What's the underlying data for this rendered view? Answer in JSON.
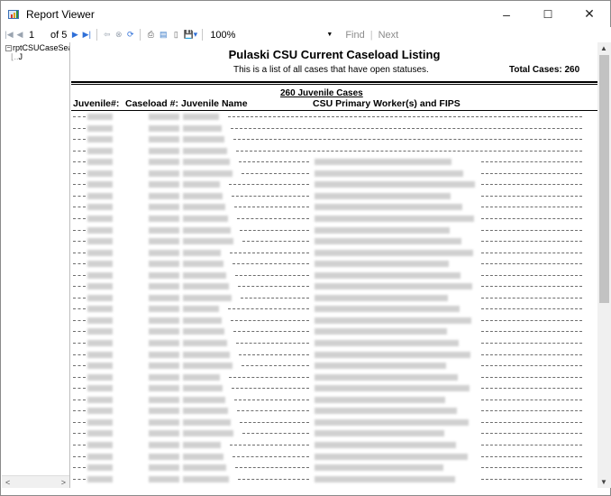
{
  "window": {
    "title": "Report Viewer",
    "minimize": "–",
    "maximize": "☐",
    "close": "✕"
  },
  "toolbar": {
    "current_page": "1",
    "of_label": "of",
    "total_pages": "5",
    "zoom": "100%",
    "find": "Find",
    "separator": "|",
    "next": "Next"
  },
  "docmap": {
    "root_toggle": "−",
    "root": "rptCSUCaseSea",
    "child": "J",
    "scroll_left": "<",
    "scroll_right": ">"
  },
  "report": {
    "title": "Pulaski CSU Current Caseload Listing",
    "subtitle": "This is a list of all cases that have open statuses.",
    "total_cases": "Total Cases: 260",
    "group_summary": "260 Juvenile Cases",
    "columns": {
      "juvenile_num": "Juvenile#:",
      "caseload_num": "Caseload #:",
      "juvenile_name": "Juvenile Name",
      "workers": "CSU Primary Worker(s) and FIPS"
    },
    "rows": [
      {
        "worker": false
      },
      {
        "worker": false
      },
      {
        "worker": false
      },
      {
        "worker": false
      },
      {
        "worker": true
      },
      {
        "worker": true
      },
      {
        "worker": true
      },
      {
        "worker": true
      },
      {
        "worker": true
      },
      {
        "worker": true
      },
      {
        "worker": true
      },
      {
        "worker": true
      },
      {
        "worker": true
      },
      {
        "worker": true
      },
      {
        "worker": true
      },
      {
        "worker": true
      },
      {
        "worker": true
      },
      {
        "worker": true
      },
      {
        "worker": true
      },
      {
        "worker": true
      },
      {
        "worker": true
      },
      {
        "worker": true
      },
      {
        "worker": true
      },
      {
        "worker": true
      },
      {
        "worker": true
      },
      {
        "worker": true
      },
      {
        "worker": true
      },
      {
        "worker": true
      },
      {
        "worker": true
      },
      {
        "worker": true
      },
      {
        "worker": true
      },
      {
        "worker": true
      },
      {
        "worker": true
      }
    ]
  },
  "icons": {
    "first": "first-page-icon",
    "prev": "previous-page-icon",
    "next": "next-page-icon",
    "last": "last-page-icon",
    "back": "back-icon",
    "stop": "stop-icon",
    "refresh": "refresh-icon",
    "print": "print-icon",
    "print_layout": "print-layout-icon",
    "page_setup": "page-setup-icon",
    "export": "export-icon"
  },
  "colors": {
    "accent_blue": "#2e6fd8",
    "disabled_gray": "#9aa4b0"
  }
}
